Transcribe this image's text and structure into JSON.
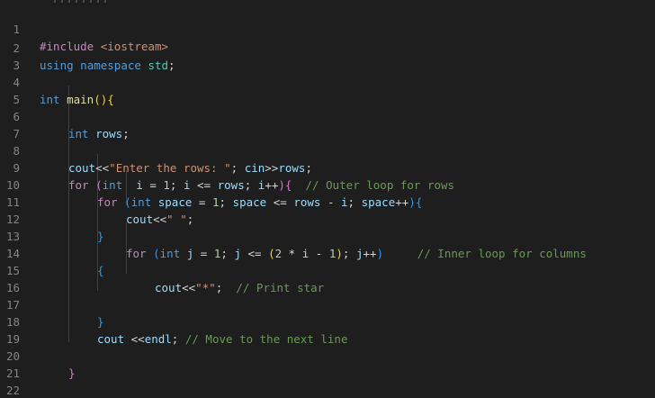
{
  "editor": {
    "line_numbers": [
      "1",
      "2",
      "3",
      "4",
      "5",
      "6",
      "7",
      "8",
      "9",
      "10",
      "11",
      "12",
      "13",
      "14",
      "15",
      "16",
      "17",
      "18",
      "19",
      "20",
      "21",
      "22"
    ],
    "lines": {
      "l1": [
        "#include",
        " ",
        "<iostream>"
      ],
      "l2": [
        "using",
        " ",
        "namespace",
        " ",
        "std",
        ";"
      ],
      "l4": [
        "int",
        " ",
        "main",
        "()",
        "{"
      ],
      "l6": [
        "int",
        " ",
        "rows",
        ";"
      ],
      "l8": [
        "cout",
        "<<",
        "\"Enter the rows: \"",
        "; ",
        "cin",
        ">>",
        "rows",
        ";"
      ],
      "l9": [
        "for",
        " ",
        "(",
        "int",
        "  ",
        "i",
        " = ",
        "1",
        "; ",
        "i",
        " <= ",
        "rows",
        "; ",
        "i",
        "++",
        ")",
        "{",
        "  ",
        "// Outer loop for rows"
      ],
      "l10": [
        "for",
        " ",
        "(",
        "int",
        " ",
        "space",
        " = ",
        "1",
        "; ",
        "space",
        " <= ",
        "rows",
        " - ",
        "i",
        "; ",
        "space",
        "++",
        ")",
        "{"
      ],
      "l11": [
        "cout",
        "<<",
        "\" \"",
        ";"
      ],
      "l12": [
        "}"
      ],
      "l13": [
        "for",
        " ",
        "(",
        "int",
        " ",
        "j",
        " = ",
        "1",
        "; ",
        "j",
        " <= ",
        "(",
        "2",
        " * ",
        "i",
        " - ",
        "1",
        ")",
        "; ",
        "j",
        "++",
        ")",
        "     ",
        "// Inner loop for columns"
      ],
      "l14": [
        "{"
      ],
      "l15": [
        "cout",
        "<<",
        "\"*\"",
        ";",
        "  ",
        "// Print star"
      ],
      "l17": [
        "}"
      ],
      "l18": [
        "cout",
        " <<",
        "endl",
        ";",
        " ",
        "// Move to the next line"
      ],
      "l20": [
        "}"
      ],
      "l22": [
        "}"
      ]
    }
  }
}
